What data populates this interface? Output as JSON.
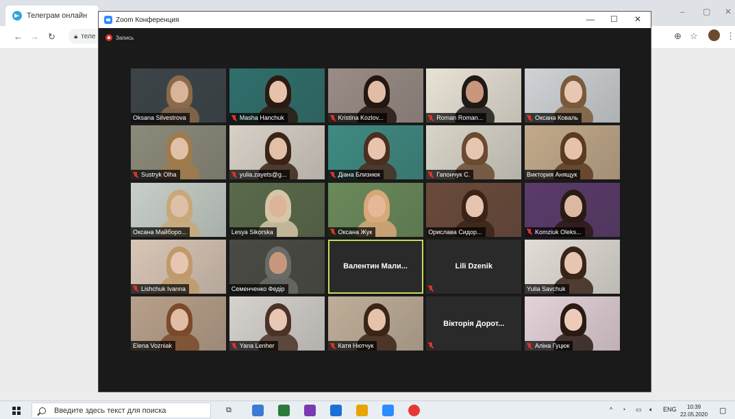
{
  "browser": {
    "tab_title": "Телеграм онлайн",
    "omnibox_text": "теле",
    "window_controls": [
      "–",
      "▢",
      "✕"
    ]
  },
  "zoom": {
    "window_title": "Zoom Конференция",
    "recording_label": "Запись",
    "window_controls": [
      "—",
      "☐",
      "✕"
    ],
    "participants": [
      {
        "name": "Oksana Silvestrova",
        "muted": false,
        "video": true,
        "bg": "#3c4448",
        "skin": "#d9b49a",
        "hair": "#8a6a4a"
      },
      {
        "name": "Masha Hanchuk",
        "muted": true,
        "video": true,
        "bg": "#2f6f6c",
        "skin": "#e6c2aa",
        "hair": "#2a1a12"
      },
      {
        "name": "Kristina Kozlov...",
        "muted": true,
        "video": true,
        "bg": "#9a8c86",
        "skin": "#e2bda6",
        "hair": "#241610"
      },
      {
        "name": "Roman Roman...",
        "muted": true,
        "video": true,
        "bg": "#e8e2d6",
        "skin": "#c9987c",
        "hair": "#1e1a18"
      },
      {
        "name": "Оксана Коваль",
        "muted": true,
        "video": true,
        "bg": "#cfd3d6",
        "skin": "#e8c7b2",
        "hair": "#7a5a3a"
      },
      {
        "name": "Sustryk Olha",
        "muted": true,
        "video": true,
        "bg": "#8c8a7a",
        "skin": "#e0c0a6",
        "hair": "#a07a4a"
      },
      {
        "name": "yulia.zayets@g...",
        "muted": true,
        "video": true,
        "bg": "#d7d0c6",
        "skin": "#e2c0a8",
        "hair": "#3a2418"
      },
      {
        "name": "Діана Близнюк",
        "muted": true,
        "video": true,
        "bg": "#3e8a82",
        "skin": "#e8c4ae",
        "hair": "#4a2e20"
      },
      {
        "name": "Гапончук С.",
        "muted": true,
        "video": true,
        "bg": "#d8d4c8",
        "skin": "#e6c6b0",
        "hair": "#6a4a30"
      },
      {
        "name": "Виктория Анящук",
        "muted": false,
        "video": true,
        "bg": "#c2a98a",
        "skin": "#e6c2aa",
        "hair": "#5a3a22"
      },
      {
        "name": "Оксана Майборо...",
        "muted": false,
        "video": true,
        "bg": "#c8cfc8",
        "skin": "#e0bfa8",
        "hair": "#c8a878"
      },
      {
        "name": "Lesya Sikorska",
        "muted": false,
        "video": true,
        "bg": "#5a6a4a",
        "skin": "#dcb49a",
        "hair": "#d6c6a8"
      },
      {
        "name": "Оксана Жук",
        "muted": true,
        "video": true,
        "bg": "#6a8a5a",
        "skin": "#e6b898",
        "hair": "#d8a878"
      },
      {
        "name": "Орислава Сидор...",
        "muted": false,
        "video": true,
        "bg": "#6a4a3a",
        "skin": "#e6c4ae",
        "hair": "#3a2418"
      },
      {
        "name": "Komziuk Oleks...",
        "muted": true,
        "video": true,
        "bg": "#5a3a6a",
        "skin": "#dcb8a2",
        "hair": "#2a1a14"
      },
      {
        "name": "Lishchuk Ivanna",
        "muted": true,
        "video": true,
        "bg": "#d8c6b6",
        "skin": "#e6c6b0",
        "hair": "#c09a6a"
      },
      {
        "name": "Семенченко Федір",
        "muted": false,
        "video": true,
        "bg": "#4a4a44",
        "skin": "#c8987c",
        "hair": "#6a6a66"
      },
      {
        "name": "Валентин Мали...",
        "muted": false,
        "video": false,
        "active": true
      },
      {
        "name": "Lili Dzenik",
        "muted": true,
        "video": false
      },
      {
        "name": "Yulia Savchuk",
        "muted": false,
        "video": true,
        "bg": "#e2ddd6",
        "skin": "#e6c6b0",
        "hair": "#3a2418"
      },
      {
        "name": "Elena Vozniak",
        "muted": false,
        "video": true,
        "bg": "#b8a08a",
        "skin": "#e2bca4",
        "hair": "#7a4a2a"
      },
      {
        "name": "Yana Lenher",
        "muted": true,
        "video": true,
        "bg": "#d6d2ce",
        "skin": "#e8c8b4",
        "hair": "#4a3226"
      },
      {
        "name": "Катя Нютчук",
        "muted": true,
        "video": true,
        "bg": "#bfae98",
        "skin": "#e6c2aa",
        "hair": "#3a2418"
      },
      {
        "name": "Вікторія Дорот...",
        "muted": true,
        "video": false
      },
      {
        "name": "Аліна Гуцюк",
        "muted": true,
        "video": true,
        "bg": "#e4d2d8",
        "skin": "#ecccb8",
        "hair": "#2a1a14"
      }
    ]
  },
  "taskbar": {
    "search_placeholder": "Введите здесь текст для поиска",
    "tray_lang": "ENG",
    "time": "10:39",
    "date": "22.05.2020",
    "app_colors": [
      "#3a7bd5",
      "#2b7a3a",
      "#7a3ab0",
      "#1e6ed8",
      "#e8a400",
      "#2d8cff",
      "#e53935"
    ]
  }
}
